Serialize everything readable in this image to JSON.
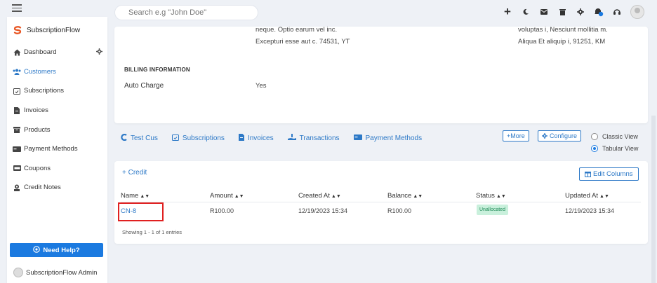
{
  "search": {
    "placeholder": "Search e.g \"John Doe\""
  },
  "icons": {
    "menu": "hamburger-icon",
    "add": "plus-icon",
    "dark_mode": "moon-icon",
    "mail": "mail-icon",
    "trash": "trash-icon",
    "settings": "gear-icon",
    "notifications": "bell-icon",
    "support": "headset-icon",
    "profile": "avatar"
  },
  "brand": {
    "name": "SubscriptionFlow",
    "color": "#e8531f"
  },
  "sidebar": {
    "items": [
      {
        "label": "Dashboard",
        "icon": "home-icon"
      },
      {
        "label": "Customers",
        "icon": "users-icon",
        "active": true
      },
      {
        "label": "Subscriptions",
        "icon": "calendar-check-icon"
      },
      {
        "label": "Invoices",
        "icon": "file-invoice-icon"
      },
      {
        "label": "Products",
        "icon": "box-icon"
      },
      {
        "label": "Payment Methods",
        "icon": "credit-card-icon"
      },
      {
        "label": "Coupons",
        "icon": "ticket-icon"
      },
      {
        "label": "Credit Notes",
        "icon": "receipt-icon"
      }
    ],
    "help_label": "Need Help?",
    "admin_label": "SubscriptionFlow Admin"
  },
  "customer": {
    "address_left_1": "neque. Optio earum vel inc.",
    "address_left_2": "Excepturi esse aut c. 74531, YT",
    "address_right_1": "voluptas i, Nesciunt mollitia m.",
    "address_right_2": "Aliqua Et aliquip i, 91251, KM",
    "billing_heading": "BILLING INFORMATION",
    "auto_charge_label": "Auto Charge",
    "auto_charge_value": "Yes"
  },
  "tabs": [
    {
      "label": "Test Cus",
      "icon": "customer-c-icon"
    },
    {
      "label": "Subscriptions",
      "icon": "calendar-check-icon"
    },
    {
      "label": "Invoices",
      "icon": "file-invoice-icon"
    },
    {
      "label": "Transactions",
      "icon": "hand-money-icon"
    },
    {
      "label": "Payment Methods",
      "icon": "credit-card-icon"
    }
  ],
  "actions": {
    "more": "+More",
    "configure": "Configure"
  },
  "view_toggle": {
    "classic": "Classic View",
    "tabular": "Tabular View",
    "selected": "tabular"
  },
  "credit_table": {
    "add_label": "+ Credit",
    "edit_columns_label": "Edit Columns",
    "columns": [
      "Name",
      "Amount",
      "Created At",
      "Balance",
      "Status",
      "Updated At"
    ],
    "rows": [
      {
        "name": "CN-8",
        "amount": "R100.00",
        "created_at": "12/19/2023 15:34",
        "balance": "R100.00",
        "status": "Unallocated",
        "updated_at": "12/19/2023 15:34"
      }
    ],
    "footer": "Showing 1 - 1 of 1 entries"
  },
  "colors": {
    "accent": "#2d79c7",
    "help_button": "#1b7ae0",
    "status_badge_bg": "#c9f0dc",
    "status_badge_text": "#1f8a57",
    "highlight": "#e02020"
  }
}
